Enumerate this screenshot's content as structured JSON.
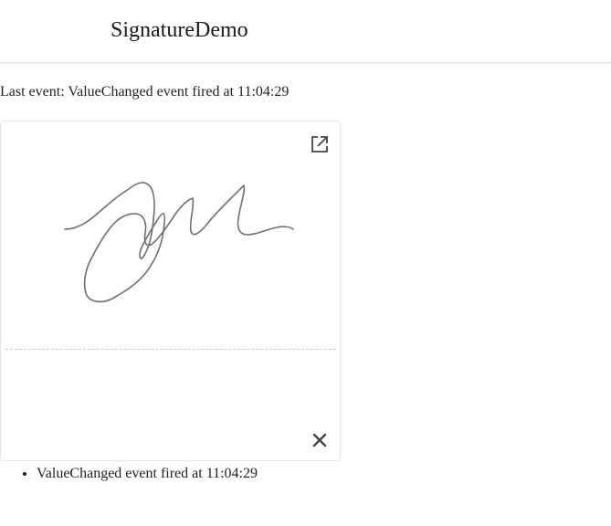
{
  "header": {
    "title": "SignatureDemo"
  },
  "status": {
    "last_event": "Last event: ValueChanged event fired at 11:04:29"
  },
  "signature": {
    "open_icon": "open-in-new-icon",
    "clear_icon": "close-icon",
    "stroke_color": "#707070",
    "baseline_color": "#b9c8e6"
  },
  "event_log": {
    "items": [
      "ValueChanged event fired at 11:04:29"
    ]
  }
}
